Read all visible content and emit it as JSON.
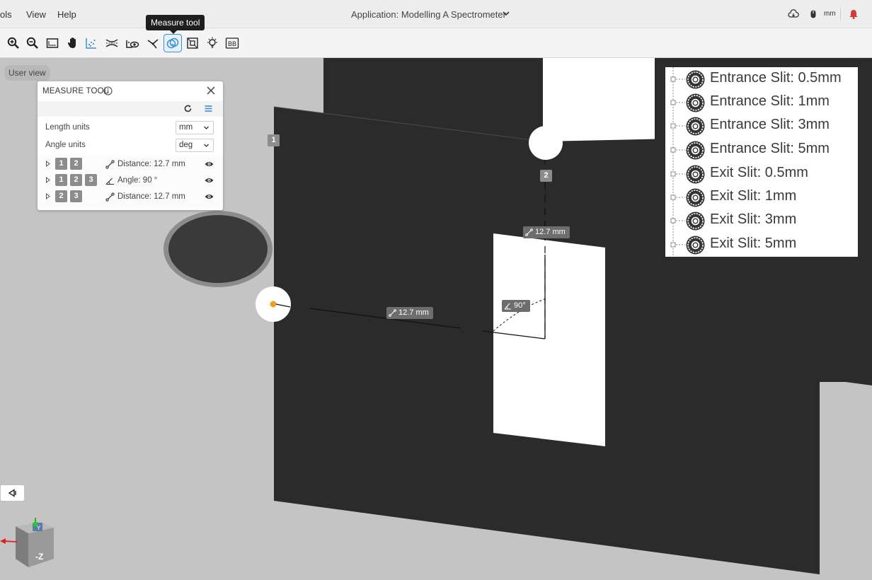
{
  "menubar": {
    "items": [
      "ols",
      "View",
      "Help"
    ],
    "app_title": "Application: Modelling A Spectrometer",
    "units": "mm"
  },
  "toolbar": {
    "tooltip": "Measure tool",
    "bb_label": "BB",
    "tools": [
      "zoom-in",
      "zoom-out",
      "fit-view",
      "pan",
      "scatter",
      "section",
      "visibility",
      "axes",
      "measure",
      "bounding-box",
      "light",
      "bb"
    ]
  },
  "viewport": {
    "user_view_label": "User view"
  },
  "measure_panel": {
    "title": "MEASURE TOOL",
    "length_units_label": "Length units",
    "length_units_value": "mm",
    "angle_units_label": "Angle units",
    "angle_units_value": "deg",
    "rows": [
      {
        "points": [
          "1",
          "2"
        ],
        "type": "distance",
        "text": "Distance: 12.7 mm"
      },
      {
        "points": [
          "1",
          "2",
          "3"
        ],
        "type": "angle",
        "text": "Angle: 90 °"
      },
      {
        "points": [
          "2",
          "3"
        ],
        "type": "distance",
        "text": "Distance: 12.7 mm"
      }
    ]
  },
  "canvas_labels": {
    "point_1": "1",
    "point_2": "2",
    "dist_vertical": "12.7 mm",
    "dist_horizontal": "12.7 mm",
    "angle": "90°"
  },
  "parts": {
    "items": [
      "Entrance Slit: 0.5mm",
      "Entrance Slit: 1mm",
      "Entrance Slit: 3mm",
      "Entrance Slit: 5mm",
      "Exit Slit: 0.5mm",
      "Exit Slit: 1mm",
      "Exit Slit: 3mm",
      "Exit Slit: 5mm"
    ]
  },
  "nav_cube": {
    "face_label": "-Z",
    "top_label": "Y"
  },
  "colors": {
    "accent": "#3a8fd6",
    "plate": "#2b2b2b",
    "background": "#c4c4c4",
    "point_marker": "#f0a020"
  }
}
